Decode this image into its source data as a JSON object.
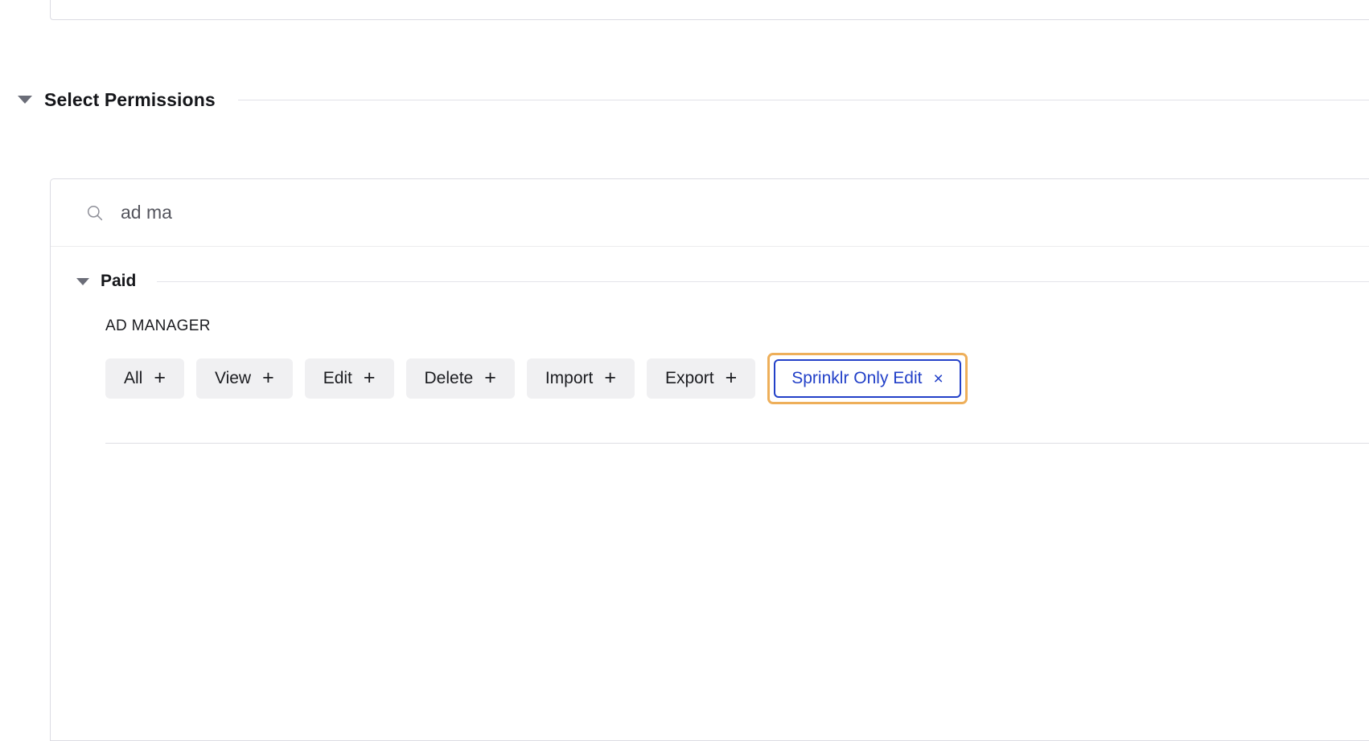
{
  "section": {
    "title": "Select Permissions",
    "caret_icon": "caret-down-icon",
    "expanded": true
  },
  "search": {
    "icon": "search-icon",
    "value": "ad ma",
    "placeholder": "Search"
  },
  "groups": [
    {
      "title": "Paid",
      "caret_icon": "caret-down-icon",
      "expanded": true,
      "permission_groups": [
        {
          "label": "AD MANAGER",
          "chips": [
            {
              "label": "All",
              "action_icon": "plus-icon",
              "selected": false
            },
            {
              "label": "View",
              "action_icon": "plus-icon",
              "selected": false
            },
            {
              "label": "Edit",
              "action_icon": "plus-icon",
              "selected": false
            },
            {
              "label": "Delete",
              "action_icon": "plus-icon",
              "selected": false
            },
            {
              "label": "Import",
              "action_icon": "plus-icon",
              "selected": false
            },
            {
              "label": "Export",
              "action_icon": "plus-icon",
              "selected": false
            },
            {
              "label": "Sprinklr Only Edit",
              "action_icon": "close-icon",
              "selected": true,
              "focused": true
            }
          ]
        }
      ]
    }
  ],
  "icons": {
    "plus": "+",
    "close": "×"
  },
  "colors": {
    "accent_blue": "#2240c8",
    "focus_orange": "#eeaf5a",
    "chip_bg": "#f0f0f2",
    "border": "#dcdce3",
    "text": "#1b1c20"
  }
}
